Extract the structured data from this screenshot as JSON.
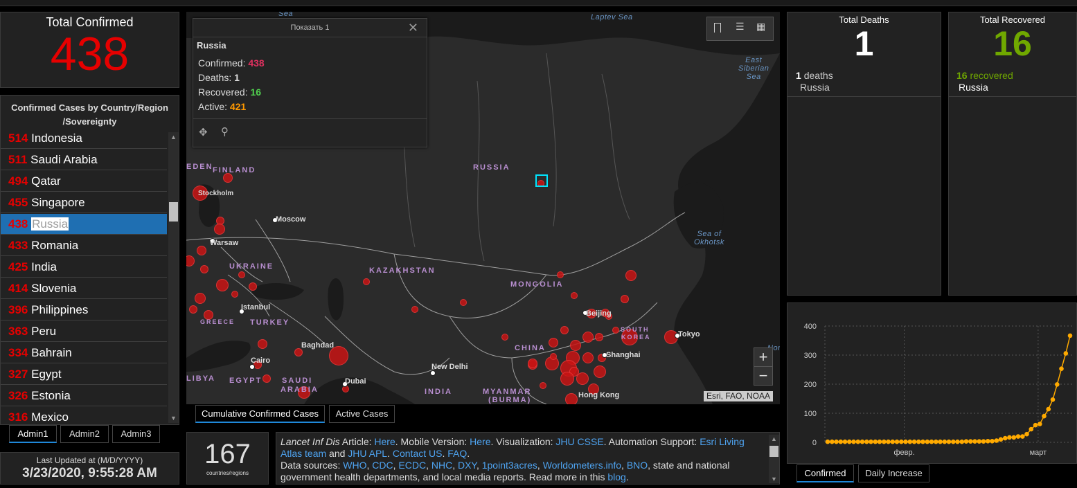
{
  "colors": {
    "confirmed": "#e60000",
    "recovered": "#70a800",
    "active": "#ff9900",
    "accent": "#1f88d9"
  },
  "total_confirmed": {
    "title": "Total Confirmed",
    "value": "438"
  },
  "country_list": {
    "title_line1": "Confirmed Cases by Country/Region",
    "title_line2": "/Sovereignty",
    "rows": [
      {
        "value": "514",
        "name": "Indonesia"
      },
      {
        "value": "511",
        "name": "Saudi Arabia"
      },
      {
        "value": "494",
        "name": "Qatar"
      },
      {
        "value": "455",
        "name": "Singapore"
      },
      {
        "value": "438",
        "name": "Russia"
      },
      {
        "value": "433",
        "name": "Romania"
      },
      {
        "value": "425",
        "name": "India"
      },
      {
        "value": "414",
        "name": "Slovenia"
      },
      {
        "value": "396",
        "name": "Philippines"
      },
      {
        "value": "363",
        "name": "Peru"
      },
      {
        "value": "334",
        "name": "Bahrain"
      },
      {
        "value": "327",
        "name": "Egypt"
      },
      {
        "value": "326",
        "name": "Estonia"
      },
      {
        "value": "316",
        "name": "Mexico"
      }
    ],
    "tabs": [
      "Admin1",
      "Admin2",
      "Admin3"
    ]
  },
  "last_updated": {
    "label": "Last Updated at (M/D/YYYY)",
    "value": "3/23/2020, 9:55:28 AM"
  },
  "popup": {
    "header": "Показать 1",
    "country": "Russia",
    "confirmed_label": "Confirmed:",
    "confirmed": "438",
    "deaths_label": "Deaths:",
    "deaths": "1",
    "recovered_label": "Recovered:",
    "recovered": "16",
    "active_label": "Active:",
    "active": "421"
  },
  "map": {
    "labels": {
      "russia": "RUSSIA",
      "finland": "FINLAND",
      "eden": "EDEN",
      "ukraine": "UKRAINE",
      "kazakhstan": "KAZAKHSTAN",
      "mongolia": "MONGOLIA",
      "china": "CHINA",
      "turkey": "TURKEY",
      "greece": "GREECE",
      "libya": "LIBYA",
      "egypt": "EGYPT",
      "saudi1": "SAUDI",
      "saudi2": "ARABIA",
      "india": "INDIA",
      "myanmar1": "MYANMAR",
      "myanmar2": "(BURMA)",
      "skorea1": "SOUTH",
      "skorea2": "KOREA",
      "moscow": "Moscow",
      "stockholm": "Stockholm",
      "warsaw": "Warsaw",
      "istanbul": "Istanbul",
      "baghdad": "Baghdad",
      "cairo": "Cairo",
      "dubai": "Dubai",
      "newdelhi": "New Delhi",
      "beijing": "Beijing",
      "shanghai": "Shanghai",
      "tokyo": "Tokyo",
      "hongkong": "Hong Kong",
      "laptev": "Laptev Sea",
      "sea_top": "Sea",
      "east1": "East",
      "east2": "Siberian",
      "east3": "Sea",
      "okh1": "Sea of",
      "okh2": "Okhotsk",
      "nor": "Nor"
    },
    "attribution": "Esri, FAO, NOAA",
    "zoom_in": "+",
    "zoom_out": "−",
    "tabs": [
      "Cumulative Confirmed Cases",
      "Active Cases"
    ]
  },
  "countries_count": {
    "value": "167",
    "label": "countries/regions"
  },
  "info_text": {
    "a1": "Lancet Inf Dis",
    "a2": " Article: ",
    "a3": "Here",
    "a4": ". Mobile Version: ",
    "a5": "Here",
    "a6": ". Visualization: ",
    "a7": "JHU CSSE",
    "a8": ". Automation Support: ",
    "a9": "Esri Living Atlas team",
    "a10": " and ",
    "a11": "JHU APL",
    "a12": ". ",
    "a13": "Contact US",
    "a14": ". ",
    "a15": "FAQ",
    "a16": ".",
    "b1": "Data sources: ",
    "b2": "WHO",
    "b3": ", ",
    "b4": "CDC",
    "b5": ", ",
    "b6": "ECDC",
    "b7": ", ",
    "b8": "NHC",
    "b9": ", ",
    "b10": "DXY",
    "b11": ", ",
    "b12": "1point3acres",
    "b13": ", ",
    "b14": "Worldometers.info",
    "b15": ", ",
    "b16": "BNO",
    "b17": ", state and national government health departments, and local media reports.  Read more in this ",
    "b18": "blog",
    "b19": "."
  },
  "total_deaths": {
    "title": "Total Deaths",
    "value": "1",
    "count": "1",
    "unit": "deaths",
    "country": "Russia"
  },
  "total_recovered": {
    "title": "Total Recovered",
    "value": "16",
    "count": "16",
    "unit": "recovered",
    "country": "Russia"
  },
  "chart_data": {
    "type": "line",
    "y_ticks": [
      "400",
      "300",
      "200",
      "100",
      "0"
    ],
    "x_ticks": [
      "февр.",
      "март"
    ],
    "ylim": [
      0,
      400
    ],
    "grid": true,
    "values": [
      2,
      2,
      2,
      2,
      2,
      2,
      2,
      2,
      2,
      2,
      2,
      2,
      2,
      2,
      2,
      2,
      2,
      2,
      2,
      2,
      2,
      2,
      2,
      2,
      2,
      2,
      2,
      2,
      2,
      2,
      2,
      2,
      3,
      3,
      3,
      3,
      3,
      4,
      4,
      6,
      10,
      14,
      17,
      17,
      20,
      20,
      28,
      45,
      59,
      63,
      90,
      114,
      147,
      199,
      253,
      306,
      367
    ],
    "tabs": [
      "Confirmed",
      "Daily Increase"
    ]
  }
}
